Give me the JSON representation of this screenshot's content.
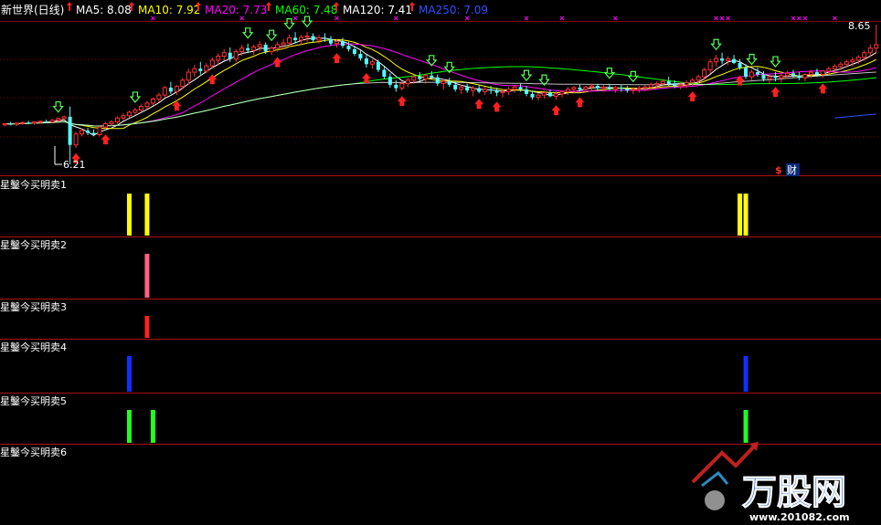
{
  "header": {
    "title": "新世界(日线)",
    "ma": [
      {
        "label": "MA5: 8.08",
        "color": "#ffffff"
      },
      {
        "label": "MA10: 7.92",
        "color": "#ffff00"
      },
      {
        "label": "MA20: 7.73",
        "color": "#ff00ff"
      },
      {
        "label": "MA60: 7.48",
        "color": "#00ff00"
      },
      {
        "label": "MA120: 7.41",
        "color": "#ffffff"
      },
      {
        "label": "MA250: 7.09",
        "color": "#3050ff"
      }
    ]
  },
  "main_panel": {
    "high_label": "8.65",
    "low_label": "6.21",
    "fin_badge": {
      "symbol": "$",
      "text": "财"
    }
  },
  "colors": {
    "up": "#ff3232",
    "down": "#54ffff",
    "grid": "#8b0000",
    "up_arrow": "#ff2020",
    "down_arrow": "#55ff55",
    "marker": "#ff00ff"
  },
  "chart_data": {
    "type": "candlestick",
    "y_range": [
      6.21,
      8.65
    ],
    "candles": [
      [
        6.9,
        6.93,
        6.87,
        6.92
      ],
      [
        6.92,
        6.95,
        6.89,
        6.91
      ],
      [
        6.91,
        6.94,
        6.88,
        6.93
      ],
      [
        6.93,
        6.96,
        6.9,
        6.94
      ],
      [
        6.94,
        6.97,
        6.91,
        6.93
      ],
      [
        6.93,
        6.96,
        6.9,
        6.95
      ],
      [
        6.95,
        6.98,
        6.92,
        6.96
      ],
      [
        6.96,
        6.99,
        6.93,
        6.95
      ],
      [
        6.95,
        7.0,
        6.93,
        6.98
      ],
      [
        6.98,
        7.03,
        6.95,
        7.01
      ],
      [
        7.01,
        7.06,
        6.98,
        7.04
      ],
      [
        7.04,
        7.22,
        6.21,
        6.55
      ],
      [
        6.55,
        6.78,
        6.5,
        6.74
      ],
      [
        6.74,
        6.84,
        6.7,
        6.8
      ],
      [
        6.8,
        6.85,
        6.72,
        6.76
      ],
      [
        6.76,
        6.82,
        6.7,
        6.73
      ],
      [
        6.73,
        6.88,
        6.7,
        6.86
      ],
      [
        6.86,
        6.95,
        6.83,
        6.92
      ],
      [
        6.92,
        6.98,
        6.88,
        6.95
      ],
      [
        6.95,
        7.05,
        6.92,
        7.02
      ],
      [
        7.02,
        7.1,
        6.98,
        7.06
      ],
      [
        7.06,
        7.15,
        7.02,
        7.12
      ],
      [
        7.12,
        7.2,
        7.08,
        7.16
      ],
      [
        7.16,
        7.26,
        7.12,
        7.22
      ],
      [
        7.22,
        7.32,
        7.18,
        7.28
      ],
      [
        7.28,
        7.38,
        7.24,
        7.35
      ],
      [
        7.35,
        7.46,
        7.3,
        7.42
      ],
      [
        7.42,
        7.58,
        7.38,
        7.55
      ],
      [
        7.55,
        7.65,
        7.44,
        7.48
      ],
      [
        7.48,
        7.6,
        7.42,
        7.57
      ],
      [
        7.57,
        7.72,
        7.52,
        7.68
      ],
      [
        7.68,
        7.88,
        7.6,
        7.82
      ],
      [
        7.82,
        7.95,
        7.74,
        7.88
      ],
      [
        7.88,
        8.0,
        7.78,
        7.84
      ],
      [
        7.84,
        7.98,
        7.8,
        7.93
      ],
      [
        7.93,
        8.08,
        7.88,
        8.03
      ],
      [
        8.03,
        8.15,
        7.95,
        8.1
      ],
      [
        8.1,
        8.22,
        8.02,
        8.16
      ],
      [
        8.16,
        8.25,
        8.0,
        8.05
      ],
      [
        8.05,
        8.22,
        8.0,
        8.18
      ],
      [
        8.18,
        8.3,
        8.1,
        8.24
      ],
      [
        8.24,
        8.32,
        8.15,
        8.2
      ],
      [
        8.2,
        8.3,
        8.12,
        8.26
      ],
      [
        8.26,
        8.36,
        8.18,
        8.3
      ],
      [
        8.3,
        8.34,
        8.14,
        8.18
      ],
      [
        8.18,
        8.28,
        8.12,
        8.24
      ],
      [
        8.24,
        8.35,
        8.18,
        8.3
      ],
      [
        8.3,
        8.4,
        8.22,
        8.33
      ],
      [
        8.33,
        8.48,
        8.26,
        8.42
      ],
      [
        8.42,
        8.52,
        8.32,
        8.38
      ],
      [
        8.38,
        8.47,
        8.3,
        8.43
      ],
      [
        8.43,
        8.52,
        8.35,
        8.45
      ],
      [
        8.45,
        8.5,
        8.34,
        8.38
      ],
      [
        8.38,
        8.47,
        8.32,
        8.42
      ],
      [
        8.42,
        8.5,
        8.35,
        8.4
      ],
      [
        8.4,
        8.45,
        8.28,
        8.32
      ],
      [
        8.32,
        8.4,
        8.25,
        8.36
      ],
      [
        8.36,
        8.42,
        8.24,
        8.28
      ],
      [
        8.28,
        8.35,
        8.18,
        8.22
      ],
      [
        8.22,
        8.28,
        8.1,
        8.14
      ],
      [
        8.14,
        8.2,
        8.02,
        8.06
      ],
      [
        8.06,
        8.12,
        7.9,
        7.96
      ],
      [
        7.96,
        8.05,
        7.88,
        8.0
      ],
      [
        8.0,
        8.04,
        7.82,
        7.86
      ],
      [
        7.86,
        7.92,
        7.7,
        7.74
      ],
      [
        7.74,
        7.8,
        7.55,
        7.6
      ],
      [
        7.6,
        7.68,
        7.48,
        7.54
      ],
      [
        7.54,
        7.66,
        7.5,
        7.62
      ],
      [
        7.62,
        7.72,
        7.56,
        7.68
      ],
      [
        7.68,
        7.78,
        7.62,
        7.74
      ],
      [
        7.74,
        7.82,
        7.66,
        7.7
      ],
      [
        7.7,
        7.8,
        7.62,
        7.76
      ],
      [
        7.76,
        7.84,
        7.7,
        7.73
      ],
      [
        7.73,
        7.78,
        7.58,
        7.62
      ],
      [
        7.62,
        7.7,
        7.52,
        7.66
      ],
      [
        7.66,
        7.72,
        7.56,
        7.6
      ],
      [
        7.6,
        7.66,
        7.48,
        7.52
      ],
      [
        7.52,
        7.6,
        7.44,
        7.56
      ],
      [
        7.56,
        7.62,
        7.46,
        7.5
      ],
      [
        7.5,
        7.58,
        7.4,
        7.54
      ],
      [
        7.54,
        7.6,
        7.45,
        7.48
      ],
      [
        7.48,
        7.56,
        7.42,
        7.52
      ],
      [
        7.52,
        7.58,
        7.44,
        7.5
      ],
      [
        7.5,
        7.55,
        7.4,
        7.46
      ],
      [
        7.46,
        7.52,
        7.38,
        7.48
      ],
      [
        7.48,
        7.56,
        7.42,
        7.52
      ],
      [
        7.52,
        7.6,
        7.46,
        7.56
      ],
      [
        7.56,
        7.62,
        7.48,
        7.52
      ],
      [
        7.52,
        7.58,
        7.4,
        7.44
      ],
      [
        7.44,
        7.5,
        7.34,
        7.38
      ],
      [
        7.38,
        7.46,
        7.32,
        7.42
      ],
      [
        7.42,
        7.5,
        7.36,
        7.46
      ],
      [
        7.46,
        7.52,
        7.38,
        7.4
      ],
      [
        7.4,
        7.48,
        7.34,
        7.44
      ],
      [
        7.44,
        7.5,
        7.38,
        7.48
      ],
      [
        7.48,
        7.56,
        7.42,
        7.52
      ],
      [
        7.52,
        7.58,
        7.45,
        7.55
      ],
      [
        7.55,
        7.6,
        7.48,
        7.52
      ],
      [
        7.52,
        7.58,
        7.46,
        7.56
      ],
      [
        7.56,
        7.62,
        7.5,
        7.58
      ],
      [
        7.58,
        7.62,
        7.5,
        7.54
      ],
      [
        7.54,
        7.6,
        7.48,
        7.56
      ],
      [
        7.56,
        7.62,
        7.5,
        7.52
      ],
      [
        7.52,
        7.58,
        7.46,
        7.55
      ],
      [
        7.55,
        7.6,
        7.48,
        7.53
      ],
      [
        7.53,
        7.58,
        7.46,
        7.5
      ],
      [
        7.5,
        7.56,
        7.44,
        7.52
      ],
      [
        7.52,
        7.58,
        7.46,
        7.54
      ],
      [
        7.54,
        7.6,
        7.48,
        7.56
      ],
      [
        7.56,
        7.64,
        7.5,
        7.6
      ],
      [
        7.6,
        7.66,
        7.54,
        7.62
      ],
      [
        7.62,
        7.7,
        7.56,
        7.66
      ],
      [
        7.66,
        7.74,
        7.58,
        7.62
      ],
      [
        7.62,
        7.68,
        7.54,
        7.58
      ],
      [
        7.58,
        7.64,
        7.52,
        7.6
      ],
      [
        7.6,
        7.68,
        7.54,
        7.64
      ],
      [
        7.64,
        7.72,
        7.58,
        7.68
      ],
      [
        7.68,
        7.78,
        7.62,
        7.74
      ],
      [
        7.74,
        7.9,
        7.68,
        7.86
      ],
      [
        7.86,
        8.05,
        7.8,
        8.0
      ],
      [
        8.0,
        8.12,
        7.92,
        8.06
      ],
      [
        8.06,
        8.16,
        7.96,
        8.02
      ],
      [
        8.02,
        8.1,
        7.94,
        8.05
      ],
      [
        8.05,
        8.12,
        7.96,
        7.98
      ],
      [
        7.98,
        8.05,
        7.86,
        7.9
      ],
      [
        7.9,
        7.96,
        7.7,
        7.74
      ],
      [
        7.74,
        7.86,
        7.68,
        7.82
      ],
      [
        7.82,
        7.9,
        7.74,
        7.78
      ],
      [
        7.78,
        7.84,
        7.66,
        7.7
      ],
      [
        7.7,
        7.78,
        7.62,
        7.74
      ],
      [
        7.74,
        7.82,
        7.66,
        7.72
      ],
      [
        7.72,
        7.8,
        7.64,
        7.76
      ],
      [
        7.76,
        7.84,
        7.7,
        7.8
      ],
      [
        7.8,
        7.86,
        7.72,
        7.76
      ],
      [
        7.76,
        7.82,
        7.68,
        7.72
      ],
      [
        7.72,
        7.8,
        7.66,
        7.78
      ],
      [
        7.78,
        7.86,
        7.72,
        7.82
      ],
      [
        7.82,
        7.88,
        7.74,
        7.78
      ],
      [
        7.78,
        7.86,
        7.72,
        7.84
      ],
      [
        7.84,
        7.92,
        7.78,
        7.88
      ],
      [
        7.88,
        7.96,
        7.82,
        7.92
      ],
      [
        7.92,
        8.0,
        7.86,
        7.96
      ],
      [
        7.96,
        8.04,
        7.9,
        8.0
      ],
      [
        8.0,
        8.08,
        7.92,
        8.03
      ],
      [
        8.03,
        8.12,
        7.96,
        8.08
      ],
      [
        8.08,
        8.2,
        8.02,
        8.16
      ],
      [
        8.16,
        8.3,
        8.08,
        8.24
      ],
      [
        8.24,
        8.65,
        8.16,
        8.3
      ]
    ],
    "up_arrows": [
      12,
      17,
      29,
      35,
      46,
      56,
      61,
      67,
      80,
      83,
      93,
      97,
      116,
      124,
      130,
      138
    ],
    "down_arrows": [
      9,
      22,
      41,
      45,
      48,
      51,
      72,
      75,
      88,
      91,
      102,
      106,
      120,
      126,
      130
    ],
    "top_markers": [
      25,
      40,
      49,
      56,
      66,
      78,
      88,
      94,
      103,
      120,
      121,
      122,
      133,
      134,
      135,
      140,
      150
    ],
    "indicators": [
      {
        "name": "星鑿今买明卖1",
        "color": "#ffff00",
        "bars": [
          21,
          24,
          124,
          125
        ]
      },
      {
        "name": "星鑿今买明卖2",
        "color": "#ff6080",
        "bars": [
          24
        ]
      },
      {
        "name": "星鑿今买明卖3",
        "color": "#ff2020",
        "bars": [
          24
        ]
      },
      {
        "name": "星鑿今买明卖4",
        "color": "#1030ff",
        "bars": [
          21,
          125
        ]
      },
      {
        "name": "星鑿今买明卖5",
        "color": "#20ff20",
        "bars": [
          21,
          25,
          125
        ]
      },
      {
        "name": "星鑿今买明卖6",
        "color": "#ffffff",
        "bars": []
      }
    ]
  },
  "watermark": {
    "name": "万股网",
    "url": "www.201082.com"
  }
}
